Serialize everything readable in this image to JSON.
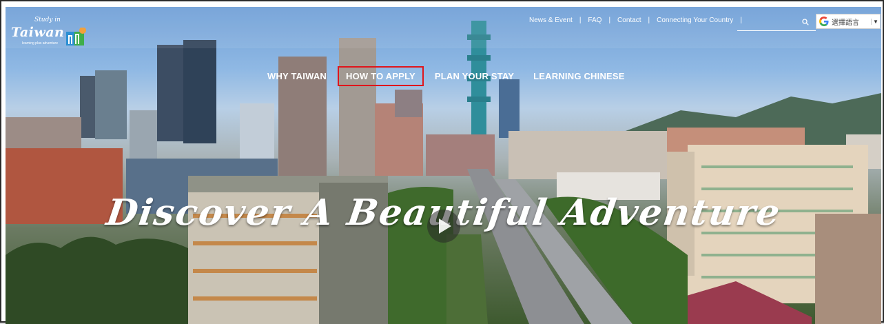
{
  "logo": {
    "script_text": "Study in",
    "wordmark": "Taiwan",
    "tagline": "learning plus adventure"
  },
  "top_links": [
    "News & Event",
    "FAQ",
    "Contact",
    "Connecting Your Country"
  ],
  "top_separator": "|",
  "search": {
    "placeholder": ""
  },
  "translate": {
    "label": "選擇語言",
    "caret": "▼"
  },
  "main_nav": [
    "WHY TAIWAN",
    "HOW TO APPLY",
    "PLAN YOUR STAY",
    "LEARNING CHINESE"
  ],
  "highlighted_nav": "HOW TO APPLY",
  "hero": {
    "headline": "Discover A Beautiful Adventure"
  },
  "icons": {
    "search": "search-icon",
    "translate": "google-g-icon",
    "play": "play-icon",
    "sun": "sun-icon"
  },
  "colors": {
    "highlight_outline": "#e0151b",
    "nav_text": "#ffffff",
    "sky": "#7aa8dc"
  }
}
